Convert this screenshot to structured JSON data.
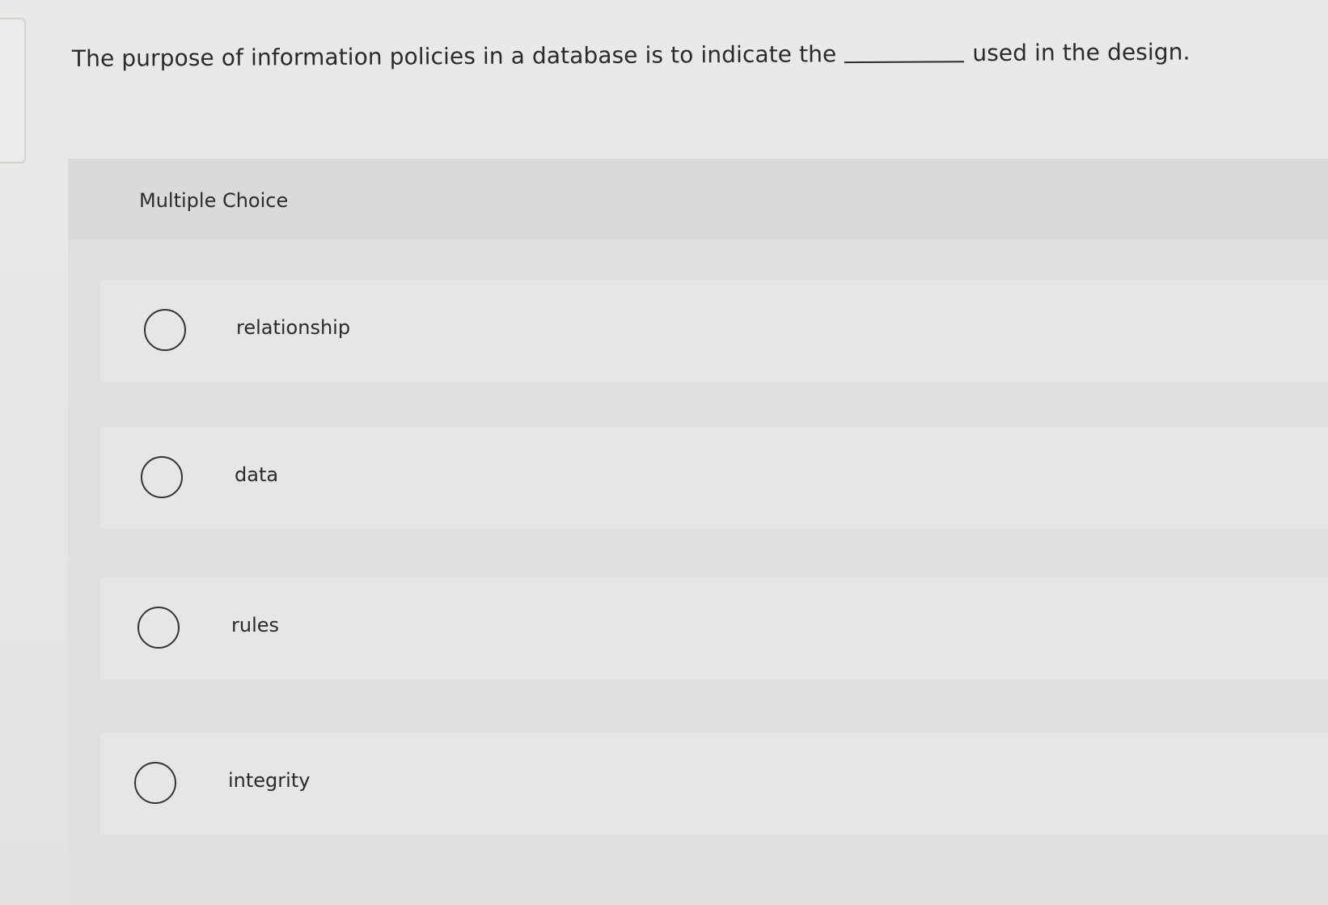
{
  "question": {
    "text_before": "The purpose of information policies in a database is to indicate the",
    "text_after": "used in the design."
  },
  "section": {
    "label": "Multiple Choice"
  },
  "options": [
    {
      "label": "relationship"
    },
    {
      "label": "data"
    },
    {
      "label": "rules"
    },
    {
      "label": "integrity"
    }
  ]
}
